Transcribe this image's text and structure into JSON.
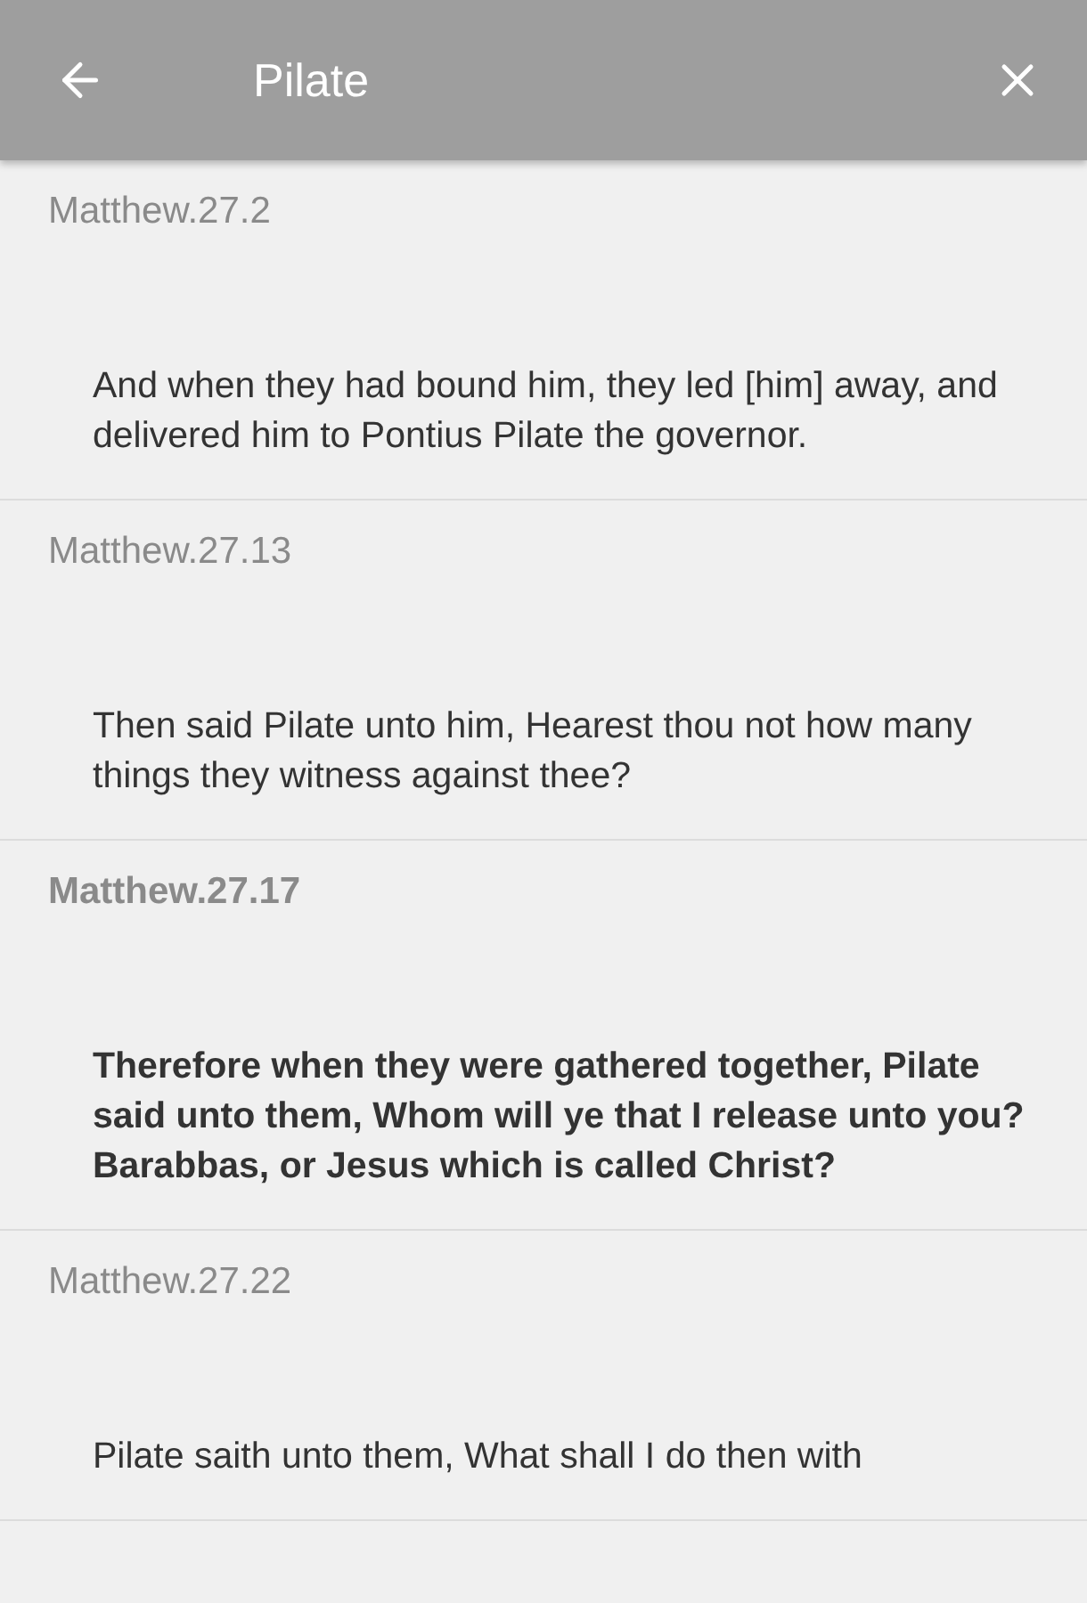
{
  "header": {
    "title": "Pilate"
  },
  "verses": [
    {
      "reference": "Matthew.27.2",
      "text": "And when they had bound him, they led [him] away, and delivered him to Pontius Pilate the governor.",
      "selected": false
    },
    {
      "reference": "Matthew.27.13",
      "text": "Then said Pilate unto him, Hearest thou not how many things they witness against thee?",
      "selected": false
    },
    {
      "reference": "Matthew.27.17",
      "text": "Therefore when they were gathered together, Pilate said unto them, Whom will ye that I release unto you? Barabbas, or Jesus which is called Christ?",
      "selected": true
    },
    {
      "reference": "Matthew.27.22",
      "text": "Pilate saith unto them, What shall I do then with",
      "selected": false
    }
  ]
}
